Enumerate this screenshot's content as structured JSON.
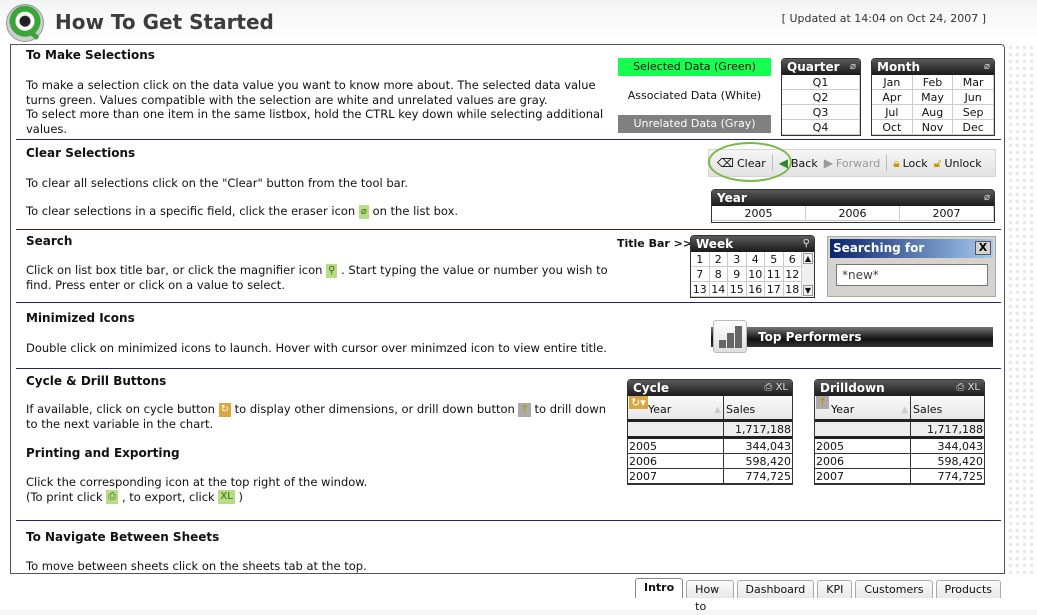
{
  "header": {
    "title": "How To Get Started",
    "updated": "[ Updated at 14:04 on Oct 24, 2007 ]"
  },
  "sections": {
    "selections": {
      "title": "To Make Selections",
      "text1": "To make a selection click on the data value you want to know more about. The selected data value turns green. Values compatible with the selection are white and unrelated values are gray.",
      "text2": "To select more than one item in the same listbox, hold the CTRL key down while selecting additional values.",
      "legend": {
        "selected": "Selected Data (Green)",
        "associated": "Associated Data (White)",
        "unrelated": "Unrelated Data (Gray)"
      }
    },
    "clear": {
      "title": "Clear Selections",
      "text1": "To clear all selections click on the \"Clear\" button from the tool bar.",
      "text2a": "To clear selections in a specific field, click the eraser icon",
      "text2b": "on the list box."
    },
    "search": {
      "title": "Search",
      "text_a": "Click on list box title bar, or click the magnifier icon",
      "text_b": ". Start typing the value or number you wish to find. Press enter or click on a value to select.",
      "title_bar_label": "Title Bar >>"
    },
    "minimized": {
      "title": "Minimized Icons",
      "text": "Double click on minimized icons to launch. Hover with cursor over minimzed icon to view entire title.",
      "icon_label": "Top Performers"
    },
    "cycle": {
      "title": "Cycle & Drill Buttons",
      "text_a": "If available, click on cycle button",
      "text_b": "to display other dimensions, or drill down button",
      "text_c": "to drill down to the next variable in the chart."
    },
    "printing": {
      "title": "Printing and Exporting",
      "text1": "Click the corresponding icon at the top right of the window.",
      "text2a": "(To print click",
      "text2b": ", to export, click",
      "text2c": ")",
      "xl_label": "XL"
    },
    "navigate": {
      "title": "To Navigate Between Sheets",
      "text": "To move between sheets click on the sheets tab at the top."
    }
  },
  "listboxes": {
    "quarter": {
      "title": "Quarter",
      "values": [
        "Q1",
        "Q2",
        "Q3",
        "Q4"
      ]
    },
    "month": {
      "title": "Month",
      "values": [
        "Jan",
        "Feb",
        "Mar",
        "Apr",
        "May",
        "Jun",
        "Jul",
        "Aug",
        "Sep",
        "Oct",
        "Nov",
        "Dec"
      ]
    },
    "year": {
      "title": "Year",
      "values": [
        "2005",
        "2006",
        "2007"
      ]
    },
    "week": {
      "title": "Week",
      "values": [
        "1",
        "2",
        "3",
        "4",
        "5",
        "6",
        "7",
        "8",
        "9",
        "10",
        "11",
        "12",
        "13",
        "14",
        "15",
        "16",
        "17",
        "18"
      ]
    }
  },
  "toolbar": {
    "clear": "Clear",
    "back": "Back",
    "forward": "Forward",
    "lock": "Lock",
    "unlock": "Unlock"
  },
  "search_box": {
    "title": "Searching for",
    "value": "*new*",
    "close": "X"
  },
  "tables": {
    "cycle": {
      "title": "Cycle",
      "col1": "Year",
      "col2": "Sales",
      "total": "1,717,188",
      "rows": [
        [
          "2005",
          "344,043"
        ],
        [
          "2006",
          "598,420"
        ],
        [
          "2007",
          "774,725"
        ]
      ],
      "xl": "XL"
    },
    "drilldown": {
      "title": "Drilldown",
      "col1": "Year",
      "col2": "Sales",
      "total": "1,717,188",
      "rows": [
        [
          "2005",
          "344,043"
        ],
        [
          "2006",
          "598,420"
        ],
        [
          "2007",
          "774,725"
        ]
      ],
      "xl": "XL"
    }
  },
  "tabs": [
    "Intro",
    "How to",
    "Dashboard",
    "KPI",
    "Customers",
    "Products"
  ],
  "active_tab": "Intro",
  "colors": {
    "selected": "#14ff50",
    "associated": "#ffffff",
    "unrelated": "#808080",
    "divider": "#22226a"
  }
}
